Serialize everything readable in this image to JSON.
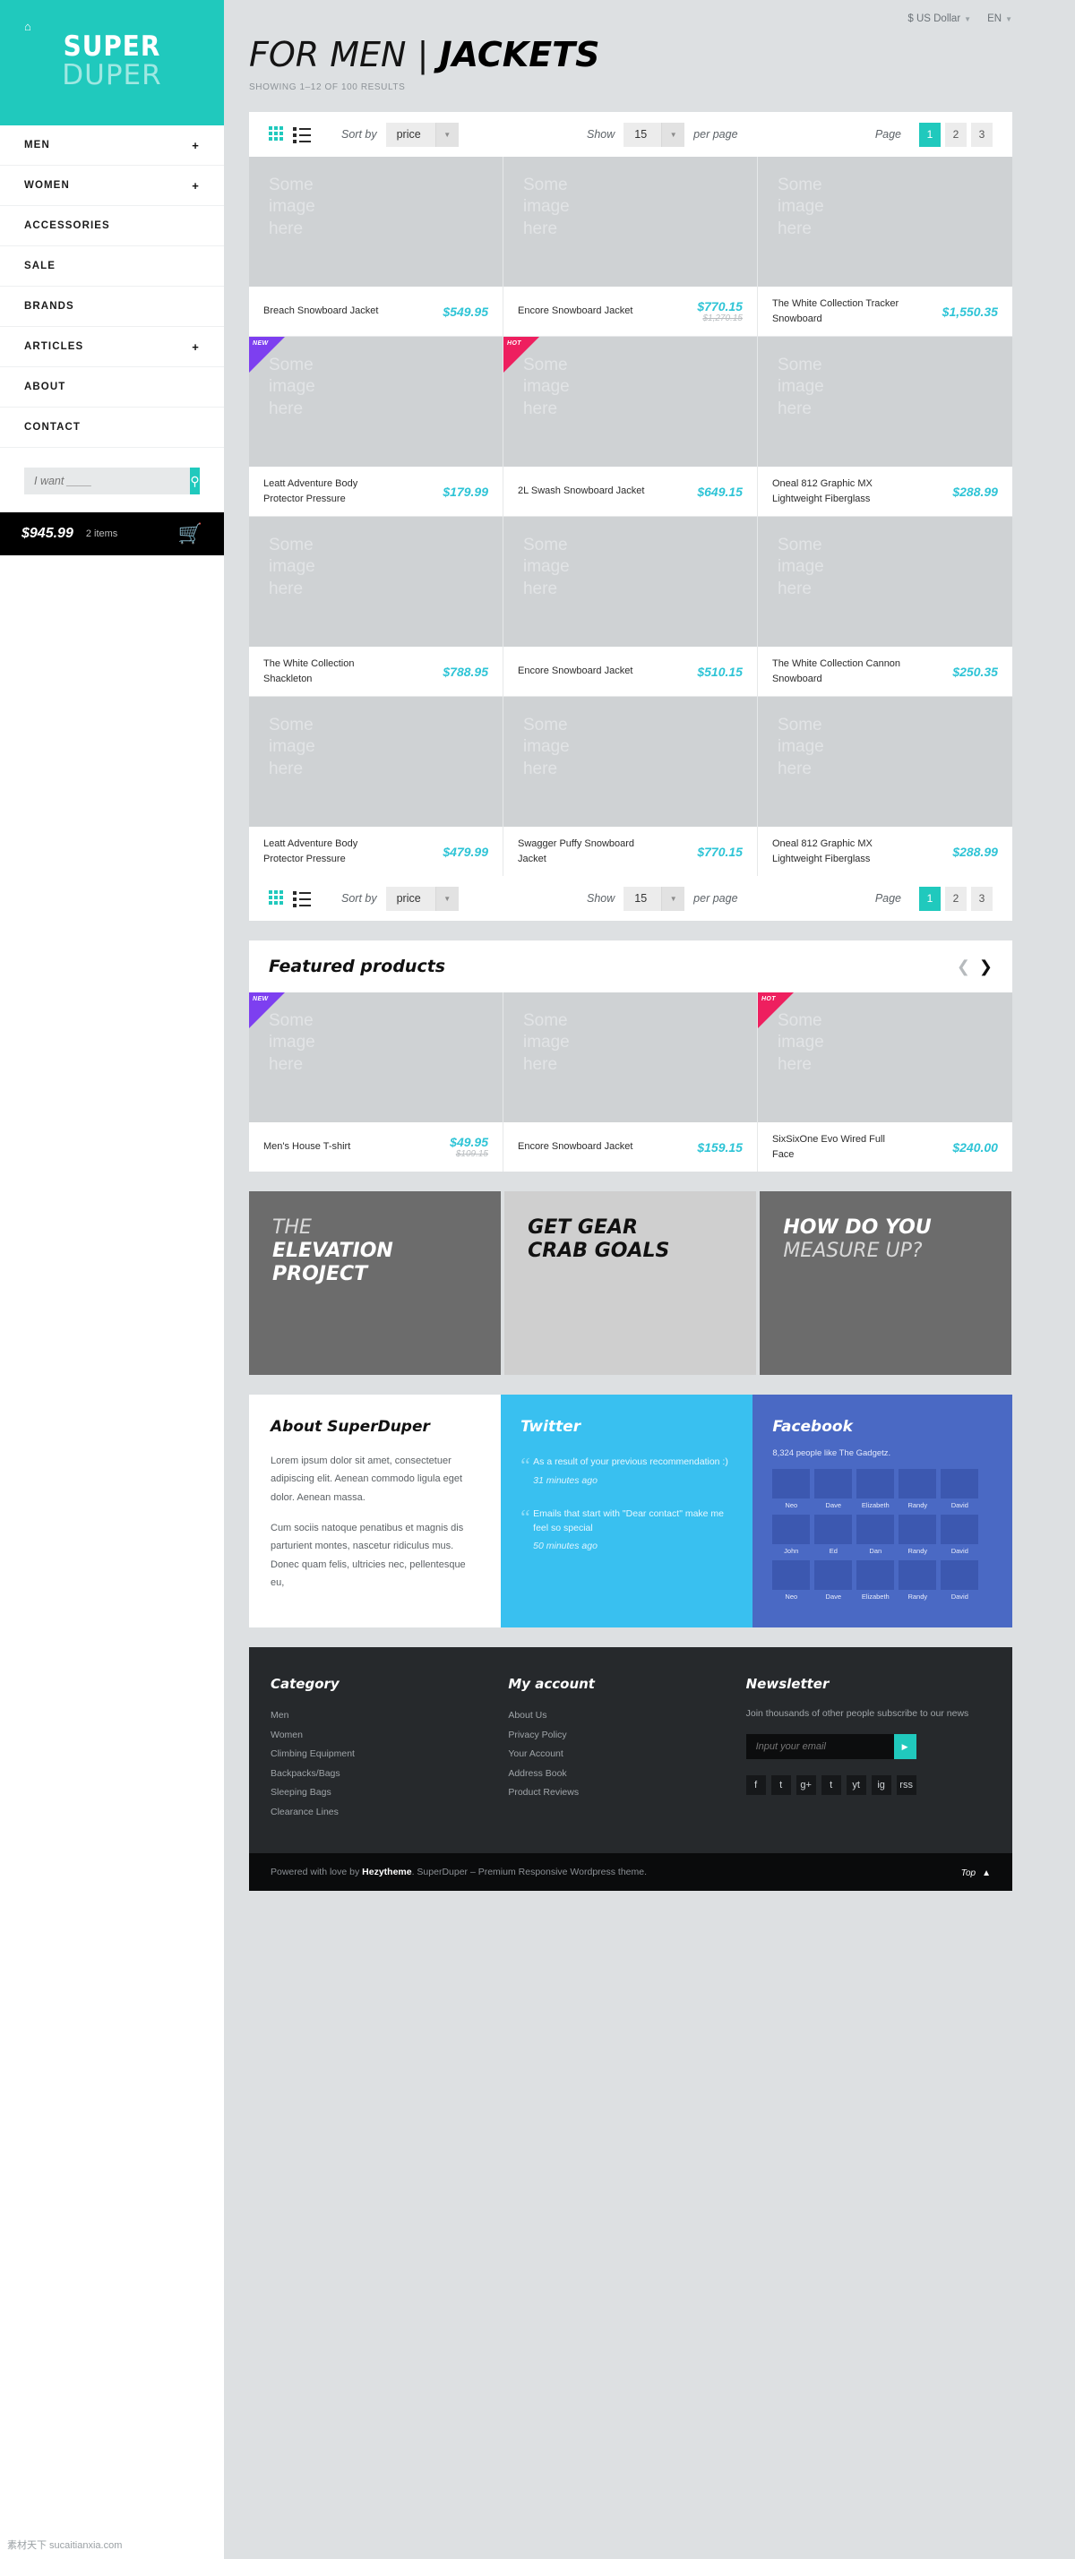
{
  "brand": {
    "top": "SUPER",
    "bottom": "DUPER",
    "home_icon": "home-icon"
  },
  "sidebar": {
    "nav": [
      {
        "label": "MEN",
        "expand": "+"
      },
      {
        "label": "WOMEN",
        "expand": "+"
      },
      {
        "label": "ACCESSORIES",
        "expand": ""
      },
      {
        "label": "SALE",
        "expand": ""
      },
      {
        "label": "BRANDS",
        "expand": ""
      },
      {
        "label": "ARTICLES",
        "expand": "+"
      },
      {
        "label": "ABOUT",
        "expand": ""
      },
      {
        "label": "CONTACT",
        "expand": ""
      }
    ],
    "search_placeholder": "I want ____",
    "search_icon": "search-icon",
    "cart": {
      "total": "$945.99",
      "items": "2 items",
      "icon": "cart-icon"
    }
  },
  "topbar": {
    "currency": "$ US Dollar",
    "language": "EN"
  },
  "header": {
    "title_light": "FOR MEN",
    "title_bar": "|",
    "title_bold": "JACKETS",
    "showing": "SHOWING 1–12 OF 100 RESULTS"
  },
  "toolbar": {
    "sort_label": "Sort by",
    "sort_value": "price",
    "show_label": "Show",
    "show_value": "15",
    "per_page_label": "per page",
    "page_label": "Page",
    "pages": [
      "1",
      "2",
      "3"
    ],
    "active_page": "1"
  },
  "image_placeholder": "Some\nimage\nhere",
  "products": [
    [
      {
        "name": "Breach Snowboard Jacket",
        "price": "$549.95",
        "old": "",
        "badge": ""
      },
      {
        "name": "Encore Snowboard Jacket",
        "price": "$770.15",
        "old": "$1,270.15",
        "badge": ""
      },
      {
        "name": "The White Collection Tracker Snowboard",
        "price": "$1,550.35",
        "old": "",
        "badge": ""
      }
    ],
    [
      {
        "name": "Leatt Adventure Body Protector Pressure",
        "price": "$179.99",
        "old": "",
        "badge": "NEW"
      },
      {
        "name": "2L Swash Snowboard Jacket",
        "price": "$649.15",
        "old": "",
        "badge": "HOT"
      },
      {
        "name": "Oneal 812 Graphic MX Lightweight Fiberglass",
        "price": "$288.99",
        "old": "",
        "badge": ""
      }
    ],
    [
      {
        "name": "The White Collection Shackleton",
        "price": "$788.95",
        "old": "",
        "badge": ""
      },
      {
        "name": "Encore Snowboard Jacket",
        "price": "$510.15",
        "old": "",
        "badge": ""
      },
      {
        "name": "The White Collection Cannon Snowboard",
        "price": "$250.35",
        "old": "",
        "badge": ""
      }
    ],
    [
      {
        "name": "Leatt Adventure Body Protector Pressure",
        "price": "$479.99",
        "old": "",
        "badge": ""
      },
      {
        "name": "Swagger Puffy Snowboard Jacket",
        "price": "$770.15",
        "old": "",
        "badge": ""
      },
      {
        "name": "Oneal 812 Graphic MX Lightweight Fiberglass",
        "price": "$288.99",
        "old": "",
        "badge": ""
      }
    ]
  ],
  "featured": {
    "title": "Featured products",
    "prev_icon": "chevron-left-icon",
    "next_icon": "chevron-right-icon",
    "items": [
      {
        "name": "Men's House T-shirt",
        "price": "$49.95",
        "old": "$109.15",
        "badge": "NEW"
      },
      {
        "name": "Encore Snowboard Jacket",
        "price": "$159.15",
        "old": "",
        "badge": ""
      },
      {
        "name": "SixSixOne Evo Wired Full Face",
        "price": "$240.00",
        "old": "",
        "badge": "HOT"
      }
    ]
  },
  "banners": [
    {
      "line1": "THE",
      "line2": "ELEVATION PROJECT",
      "style": "dark"
    },
    {
      "line1": "GET GEAR",
      "line2": "CRAB GOALS",
      "style": "light"
    },
    {
      "line1": "HOW DO YOU",
      "line2": "MEASURE UP?",
      "style": "dark",
      "reverse": true
    }
  ],
  "about": {
    "title": "About SuperDuper",
    "p1": "Lorem ipsum dolor sit amet, consectetuer adipiscing elit. Aenean commodo ligula eget dolor. Aenean massa.",
    "p2": "Cum sociis natoque penatibus et magnis dis parturient montes, nascetur ridiculus mus. Donec quam felis, ultricies nec, pellentesque eu,"
  },
  "twitter": {
    "title": "Twitter",
    "tweets": [
      {
        "text": "As a result of your previous recommendation :)",
        "time": "31 minutes ago"
      },
      {
        "text": "Emails that start with \"Dear contact\" make me feel so special",
        "time": "50 minutes ago"
      }
    ]
  },
  "facebook": {
    "title": "Facebook",
    "count": "8,324 people like The Gadgetz.",
    "faces": [
      "Neo",
      "Dave",
      "Elizabeth",
      "Randy",
      "David",
      "John",
      "Ed",
      "Dan",
      "Randy",
      "David",
      "Neo",
      "Dave",
      "Elizabeth",
      "Randy",
      "David"
    ]
  },
  "footer": {
    "category": {
      "title": "Category",
      "links": [
        "Men",
        "Women",
        "Climbing Equipment",
        "Backpacks/Bags",
        "Sleeping Bags",
        "Clearance Lines"
      ]
    },
    "account": {
      "title": "My account",
      "links": [
        "About Us",
        "Privacy Policy",
        "Your Account",
        "Address Book",
        "Product Reviews"
      ]
    },
    "newsletter": {
      "title": "Newsletter",
      "desc": "Join thousands of other people subscribe to our news",
      "placeholder": "Input your email",
      "submit_icon": "play-arrow-icon",
      "social": [
        "f",
        "t",
        "g+",
        "t",
        "yt",
        "ig",
        "rss"
      ]
    }
  },
  "copyright": {
    "prefix": "Powered with love by ",
    "brand": "Hezytheme",
    "suffix": ". SuperDuper – Premium Responsive Wordpress theme.",
    "top_label": "Top",
    "top_icon": "▲"
  },
  "watermark": "素材天下 sucaitianxia.com"
}
